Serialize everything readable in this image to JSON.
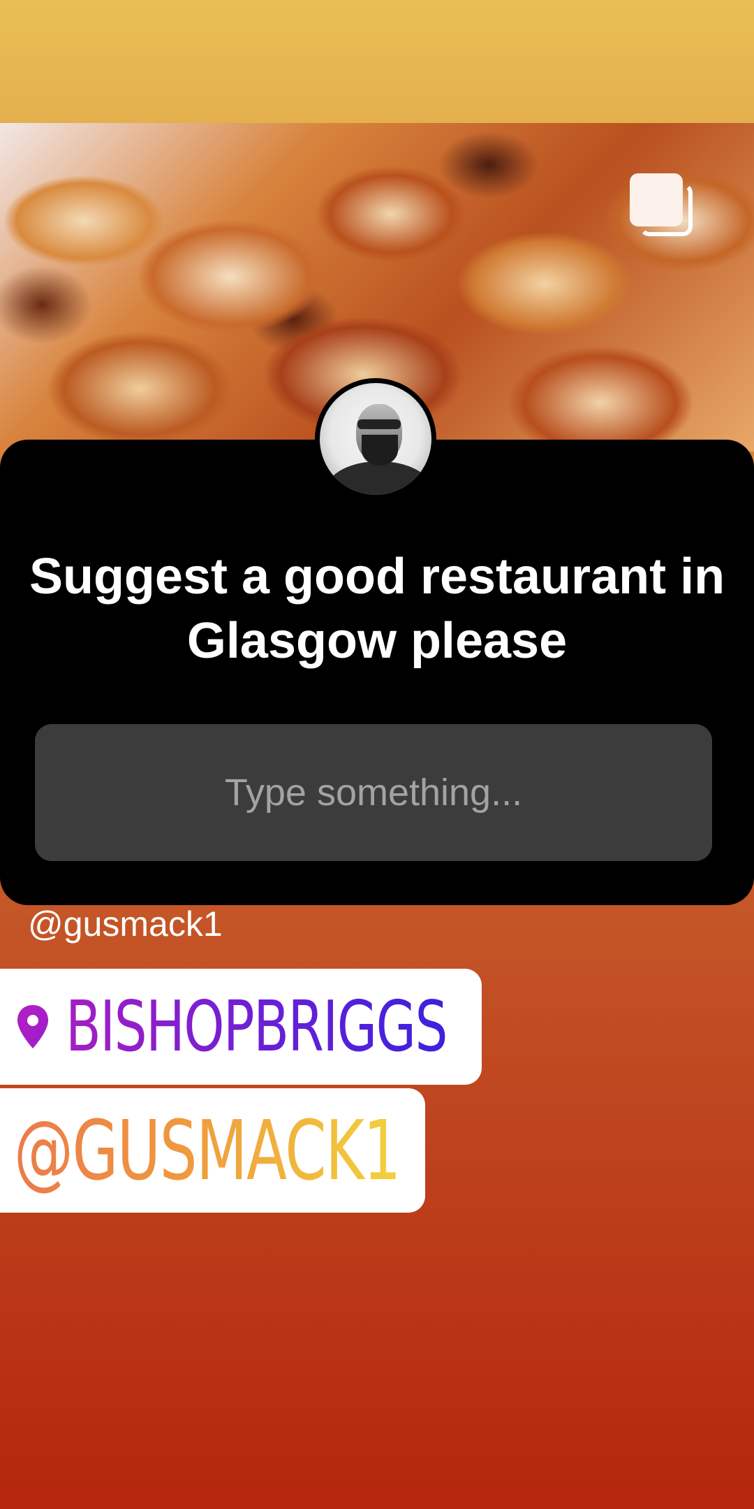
{
  "story": {
    "question": {
      "text": "Suggest a good restaurant in Glasgow please",
      "answer_placeholder": "Type something..."
    },
    "mention_caption": "@gusmack1",
    "location_sticker": {
      "label": "BISHOPBRIGGS",
      "icon": "location-pin-icon"
    },
    "mention_sticker": {
      "label": "@GUSMACK1"
    },
    "top_right_icon": "gallery-multiple-icon",
    "avatar_icon": "profile-avatar"
  },
  "colors": {
    "top_band": "#e9bf55",
    "background_bottom": "#b4260d",
    "card_background": "#000000",
    "input_background": "#3c3c3c",
    "placeholder_text": "#a3a3a3",
    "location_gradient": [
      "#a51ec4",
      "#3b22dc"
    ],
    "mention_gradient": [
      "#ec7a4a",
      "#f2d13c"
    ]
  }
}
